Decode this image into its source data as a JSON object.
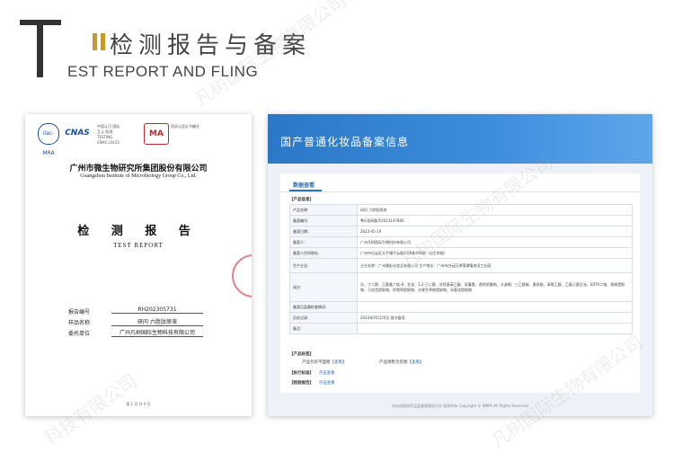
{
  "header": {
    "title_cn": "检测报告与备案",
    "title_en": "EST REPORT AND FLING"
  },
  "watermark": {
    "text": "凡树国际生物有限公司",
    "partial_bottom": "科技有限公司"
  },
  "report": {
    "logos": {
      "ilac": "ilac-MRA",
      "cnas": "CNAS",
      "cnas_cert": "中国认可 国际互认 检测 TESTING CNAS L0433",
      "cma": "MA",
      "cma_cert": "资质认定证书编号"
    },
    "org_cn": "广州市微生物研究所集团股份有限公司",
    "org_en": "Guangzhou Institute of Microbiology Group Co., Ltd.",
    "title_cn": "检 测 报 告",
    "title_en": "TEST REPORT",
    "fields": [
      {
        "label": "报告编号",
        "value": "RH202305731"
      },
      {
        "label": "样品名称",
        "value": "研问 六胜肽原液"
      },
      {
        "label": "委托单位",
        "value": "广州凡树国际生物科技有限公司"
      }
    ],
    "footer": "第 1 页 共 4 页"
  },
  "filing": {
    "site_title": "国产普通化妆品备案信息",
    "tab": "数据查看",
    "section_product": "【产品信息】",
    "rows": [
      {
        "k": "产品名称:",
        "v": "研问 六胜肽原液"
      },
      {
        "k": "备案编号:",
        "v": "粤G妆网备字2023147866"
      },
      {
        "k": "备案日期:",
        "v": "2023-05-19"
      },
      {
        "k": "备案人:",
        "v": "广州凡树国际生物科技有限公司"
      },
      {
        "k": "备案人住所地址:",
        "v": "广州市白云区太平镇平云路1号B栋406房（自主申报）"
      },
      {
        "k": "生产企业:",
        "v": "企业名称：广州雅彩化妆品有限公司 生产地址：广州市白云区钟落潭镇良田工业园"
      },
      {
        "k": "成分:",
        "v": "水、丁二醇、乙酰基六肽-8、甘油、1,2-己二醇、对羟基苯乙酮、尿囊素、透明质酸钠、卡波姆、三乙醇胺、黄原胶、苯氧乙醇、乙基己基甘油、EDTA二钠、桃果提取物、马齿苋提取物、积雪草提取物、光果甘草根提取物、母菊花提取物"
      },
      {
        "k": "备案后监督检查情况:",
        "v": ""
      },
      {
        "k": "历史记录:",
        "v": "2023年05月20日 首次备案"
      },
      {
        "k": "备注:",
        "v": ""
      }
    ],
    "section_label": "【产品标签】",
    "label_items": [
      {
        "name": "产品包装平面图",
        "link": "查看"
      },
      {
        "name": "产品销售包装图",
        "link": "查看"
      }
    ],
    "section_exec": "【执行标准】",
    "exec_link": "点击查看",
    "section_test": "【检验报告】",
    "test_link": "点击查看",
    "footer": "本站由国家药品监督管理局主办 版权所有 Copyright © NMPA All Rights Reserved"
  }
}
